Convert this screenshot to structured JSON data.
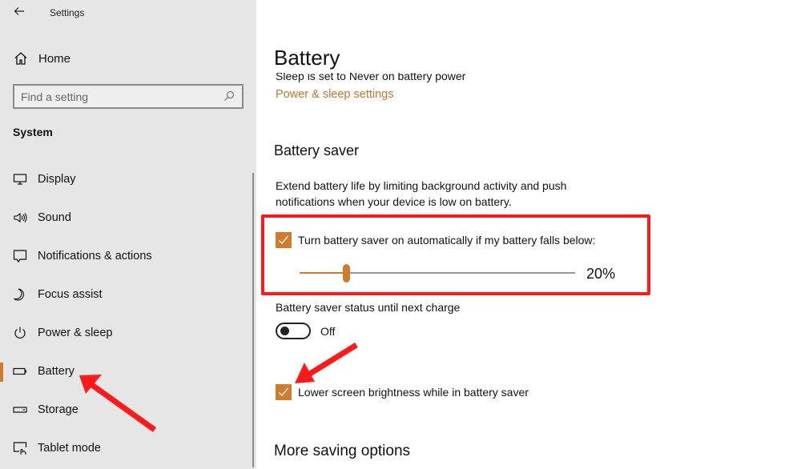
{
  "window": {
    "app_title": "Settings",
    "back_icon": "back-arrow-icon"
  },
  "sidebar": {
    "home": {
      "label": "Home",
      "icon": "home-icon"
    },
    "search": {
      "placeholder": "Find a setting",
      "value": "",
      "icon": "search-icon"
    },
    "section_label": "System",
    "items": [
      {
        "label": "Display",
        "icon": "display-icon",
        "active": false
      },
      {
        "label": "Sound",
        "icon": "sound-icon",
        "active": false
      },
      {
        "label": "Notifications & actions",
        "icon": "notifications-icon",
        "active": false
      },
      {
        "label": "Focus assist",
        "icon": "moon-icon",
        "active": false
      },
      {
        "label": "Power & sleep",
        "icon": "power-icon",
        "active": false
      },
      {
        "label": "Battery",
        "icon": "battery-icon",
        "active": true
      },
      {
        "label": "Storage",
        "icon": "storage-icon",
        "active": false
      },
      {
        "label": "Tablet mode",
        "icon": "tablet-mode-icon",
        "active": false
      }
    ]
  },
  "main": {
    "title": "Battery",
    "sleep_text": "Sleep is set to Never on battery power",
    "power_link": "Power & sleep settings",
    "battery_saver": {
      "heading": "Battery saver",
      "description": "Extend battery life by limiting background activity and push notifications when your device is low on battery.",
      "auto_checkbox": {
        "label": "Turn battery saver on automatically if my battery falls below:",
        "checked": true
      },
      "threshold_slider": {
        "value_percent": 20,
        "display": "20%"
      },
      "status_label": "Battery saver status until next charge",
      "status_toggle": {
        "on": false,
        "text": "Off"
      },
      "brightness_checkbox": {
        "label": "Lower screen brightness while in battery saver",
        "checked": true
      }
    },
    "more_heading": "More saving options"
  },
  "colors": {
    "accent": "#d07c2c",
    "link": "#c0772e",
    "annotation": "#ff1a1a",
    "sidebar_bg": "#e6e6e6"
  },
  "annotations": {
    "highlight_target": "battery-saver-auto-setting",
    "arrows": [
      "points-to-battery-nav-item",
      "points-to-brightness-checkbox"
    ]
  }
}
